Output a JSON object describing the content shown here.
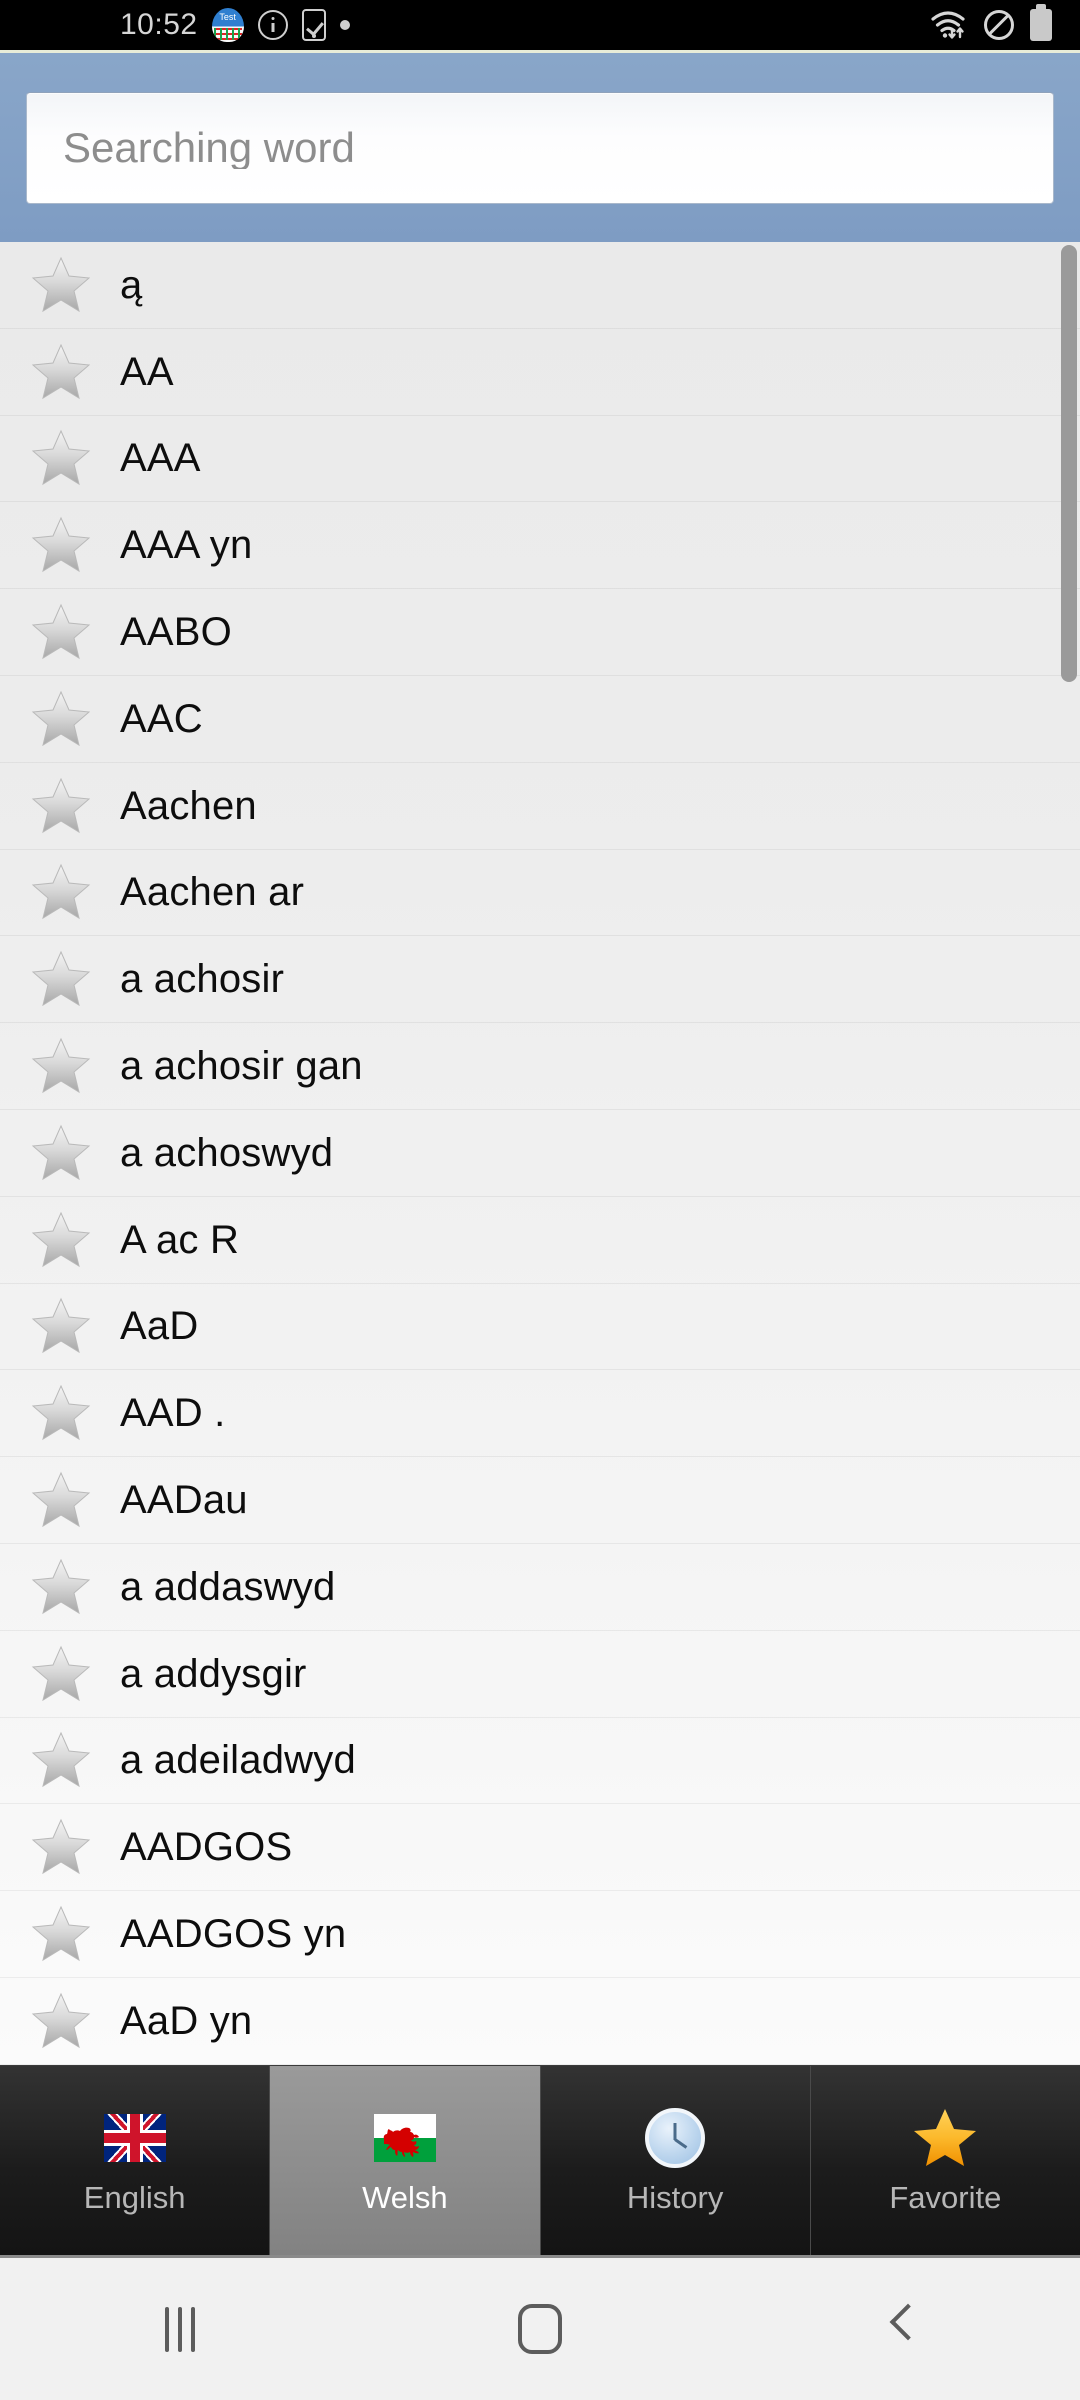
{
  "statusbar": {
    "time": "10:52",
    "icons_left": [
      "test-app-icon",
      "info-icon",
      "phone-check-icon",
      "dot-icon"
    ],
    "icons_right": [
      "wifi-icon",
      "do-not-disturb-icon",
      "battery-icon"
    ]
  },
  "search": {
    "placeholder": "Searching word",
    "value": "",
    "clear_icon": "clear-octagon-x-icon"
  },
  "list": {
    "favorite_icon": "star-outline-icon",
    "items": [
      {
        "label": "ą"
      },
      {
        "label": "AA"
      },
      {
        "label": "AAA"
      },
      {
        "label": "AAA yn"
      },
      {
        "label": "AABO"
      },
      {
        "label": "AAC"
      },
      {
        "label": "Aachen"
      },
      {
        "label": "Aachen ar"
      },
      {
        "label": "a achosir"
      },
      {
        "label": "a achosir gan"
      },
      {
        "label": "a achoswyd"
      },
      {
        "label": "A ac R"
      },
      {
        "label": "AaD"
      },
      {
        "label": "AAD ."
      },
      {
        "label": "AADau"
      },
      {
        "label": "a addaswyd"
      },
      {
        "label": "a addysgir"
      },
      {
        "label": "a adeiladwyd"
      },
      {
        "label": "AADGOS"
      },
      {
        "label": "AADGOS yn"
      },
      {
        "label": "AaD yn"
      }
    ]
  },
  "tabs": [
    {
      "label": "English",
      "icon": "uk-flag-icon",
      "selected": false
    },
    {
      "label": "Welsh",
      "icon": "wales-flag-icon",
      "selected": true
    },
    {
      "label": "History",
      "icon": "clock-icon",
      "selected": false
    },
    {
      "label": "Favorite",
      "icon": "gold-star-icon",
      "selected": false
    }
  ],
  "navbar": {
    "recents_label": "recents-icon",
    "home_label": "home-icon",
    "back_label": "back-icon"
  },
  "colors": {
    "header_blue": "#7e9cc3",
    "tab_selected_gray": "#8d8d8d",
    "tab_bg_dark": "#1c1c1c",
    "clear_red": "#cf8686",
    "wales_green": "#00a03c",
    "wales_red": "#d40000",
    "star_gold": "#f5a623"
  }
}
